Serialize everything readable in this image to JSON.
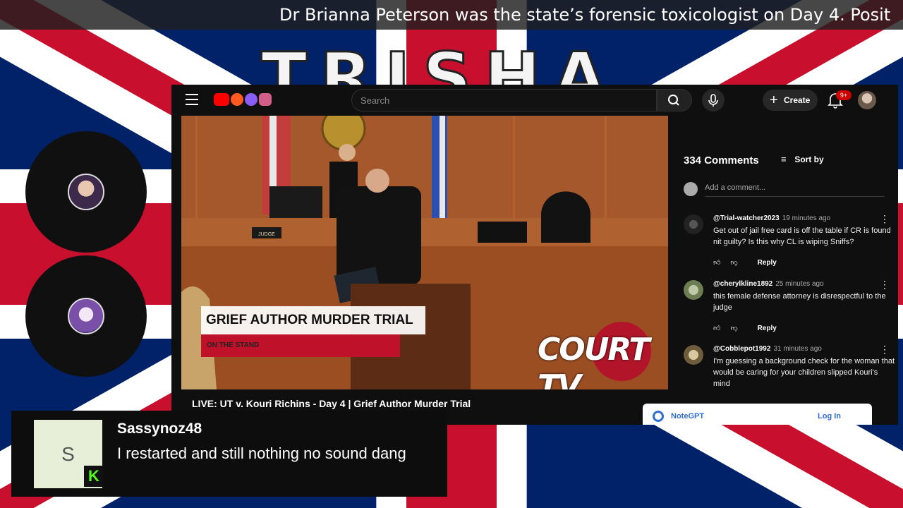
{
  "ticker": {
    "text": "Dr Brianna Peterson was the state’s forensic toxicologist on Day 4. Posit"
  },
  "banner": {
    "text": "TRISHA"
  },
  "cams": [
    {
      "icon": "avatar-blonde"
    },
    {
      "icon": "avatar-anime"
    }
  ],
  "youtube": {
    "search_placeholder": "Search",
    "create_label": "Create",
    "notifications_badge": "9+",
    "video": {
      "lower_third_title": "GRIEF AUTHOR MURDER TRIAL",
      "lower_third_sub": "ON THE STAND",
      "watermark": "COURT TV",
      "nameplate": "JUDGE"
    },
    "video_title": "LIVE: UT v. Kouri Richins - Day 4 | Grief Author Murder Trial",
    "comments": {
      "count_label": "334 Comments",
      "sort_label": "Sort by",
      "add_placeholder": "Add a comment...",
      "reply_label": "Reply",
      "items": [
        {
          "author": "@Trial-watcher2023",
          "time": "19 minutes ago",
          "text": "Get out of jail free card is off the table if CR is found nit guilty? Is this why CL is wiping Sniffs?"
        },
        {
          "author": "@cherylkline1892",
          "time": "25 minutes ago",
          "text": "this female defense attorney is disrespectful to the judge"
        },
        {
          "author": "@Cobblepot1992",
          "time": "31 minutes ago",
          "text": "I'm guessing a background check for the woman that would be caring for your children slipped Kouri's mind"
        }
      ]
    },
    "notegpt": {
      "label": "NoteGPT",
      "login": "Log In"
    }
  },
  "chat": {
    "avatar_letter": "S",
    "platform_badge": "K",
    "username": "Sassynoz48",
    "message": "I restarted and still nothing no sound dang"
  },
  "colors": {
    "red": "#c8102e",
    "navy": "#012169",
    "yt_bg": "#0f0f0f",
    "kick_green": "#53fc18"
  }
}
